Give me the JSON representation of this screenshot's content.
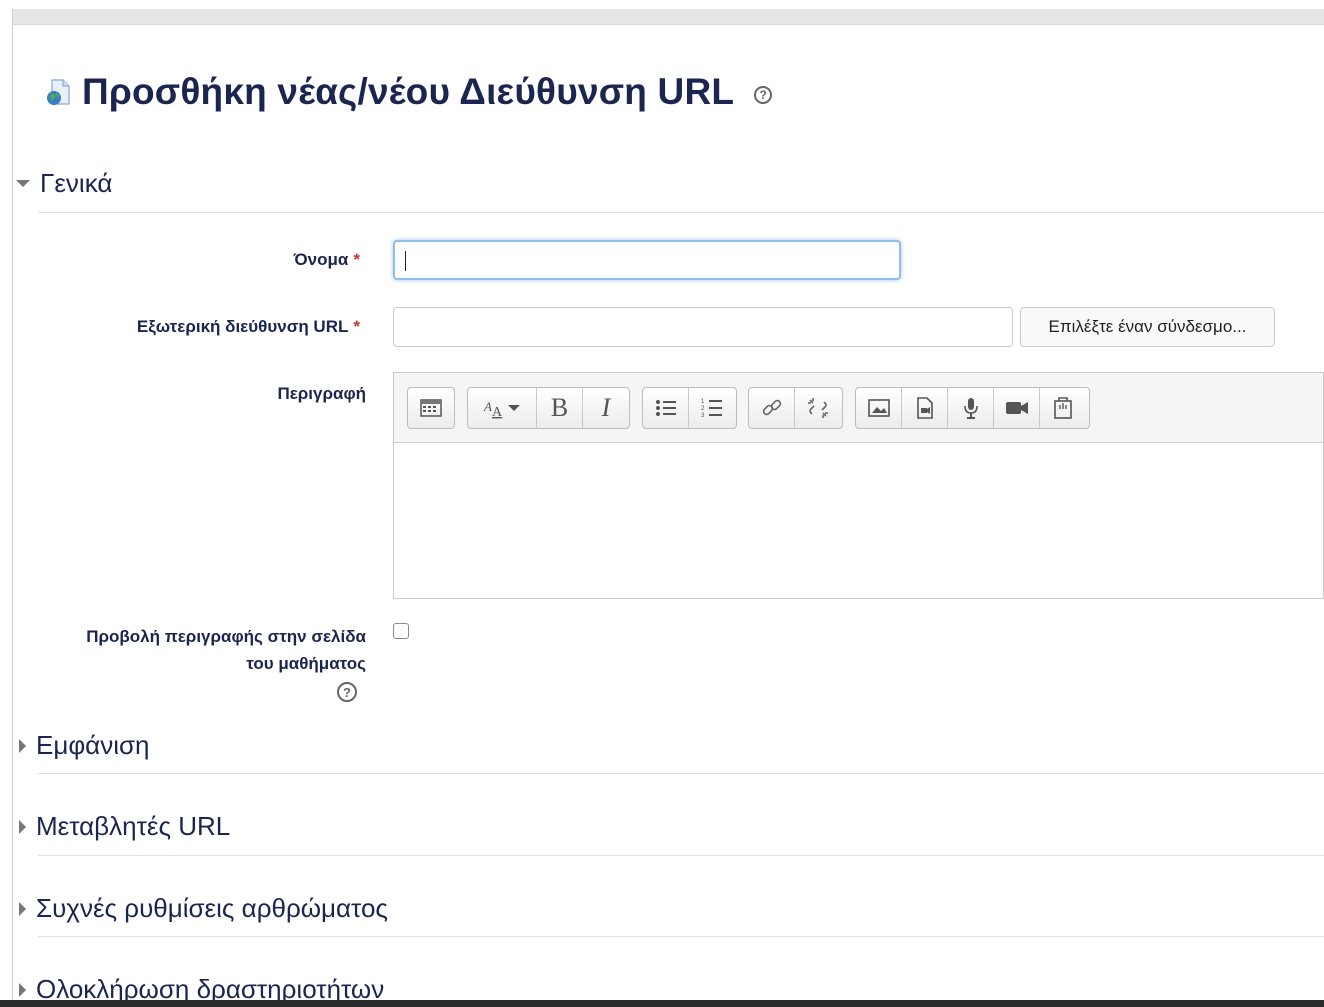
{
  "page": {
    "title": "Προσθήκη νέας/νέου Διεύθυνση URL",
    "help_glyph": "?"
  },
  "sections": {
    "general": "Γενικά",
    "appearance": "Εμφάνιση",
    "url_variables": "Μεταβλητές URL",
    "common_module_settings": "Συχνές ρυθμίσεις αρθρώματος",
    "activity_completion": "Ολοκλήρωση δραστηριοτήτων"
  },
  "fields": {
    "name": {
      "label": "Όνομα",
      "value": "",
      "required_marker": "*"
    },
    "external_url": {
      "label": "Εξωτερική διεύθυνση URL",
      "value": "",
      "required_marker": "*"
    },
    "choose_link_button": "Επιλέξτε έναν σύνδεσμο...",
    "description": {
      "label": "Περιγραφή",
      "value": ""
    },
    "show_description": {
      "label_line1": "Προβολή περιγραφής στην σελίδα",
      "label_line2": "του μαθήματος",
      "checked": false
    }
  },
  "editor_toolbar": {
    "buttons": [
      "toolbar-toggle-icon",
      "font-style-icon",
      "bold-icon",
      "italic-icon",
      "bullet-list-icon",
      "numbered-list-icon",
      "link-icon",
      "unlink-icon",
      "image-icon",
      "media-icon",
      "record-audio-icon",
      "record-video-icon",
      "manage-files-icon"
    ],
    "bold_label": "B",
    "italic_label": "I"
  },
  "colors": {
    "heading": "#1a2550",
    "required": "#c0392b",
    "focus_border": "#8fbfe8"
  }
}
